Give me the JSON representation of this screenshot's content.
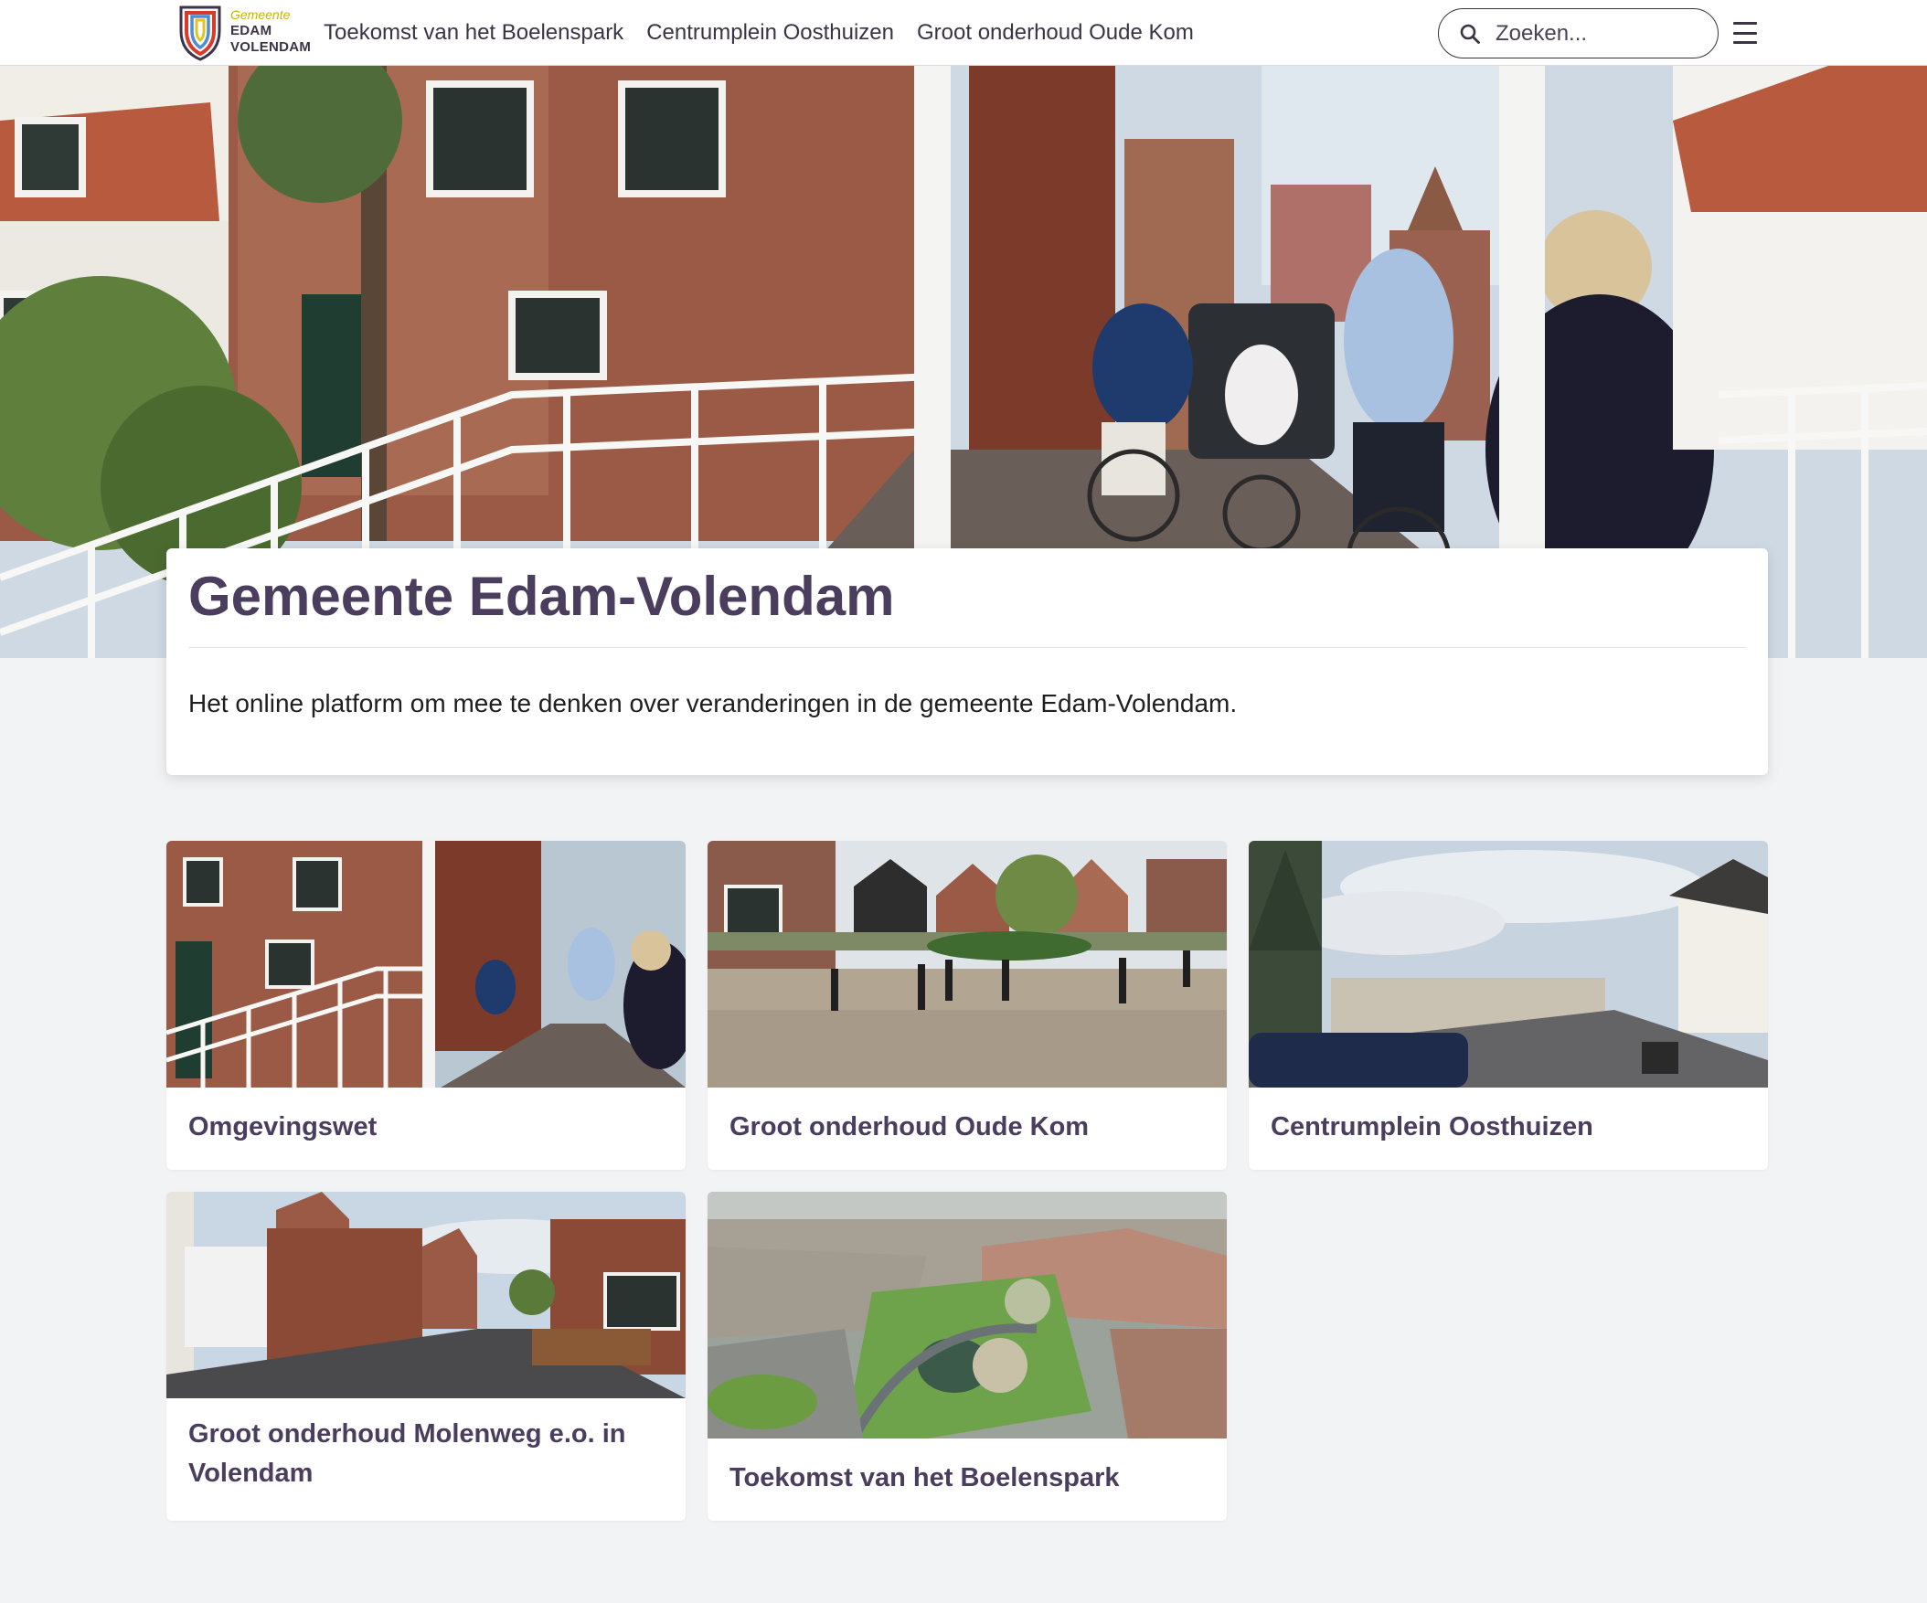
{
  "header": {
    "logo": {
      "line1": "Gemeente",
      "line2": "EDAM",
      "line3": "VOLENDAM"
    },
    "nav": [
      {
        "label": "Toekomst van het Boelenspark"
      },
      {
        "label": "Centrumplein Oosthuizen"
      },
      {
        "label": "Groot onderhoud Oude Kom"
      }
    ],
    "search": {
      "placeholder": "Zoeken..."
    }
  },
  "intro": {
    "title": "Gemeente Edam-Volendam",
    "description": "Het online platform om mee te denken over veranderingen in de gemeente Edam-Volendam."
  },
  "projects": [
    {
      "title": "Omgevingswet"
    },
    {
      "title": "Groot onderhoud Oude Kom"
    },
    {
      "title": "Centrumplein Oosthuizen"
    },
    {
      "title": "Groot onderhoud Molenweg e.o. in Volendam"
    },
    {
      "title": "Toekomst van het Boelenspark"
    }
  ],
  "colors": {
    "brand_purple": "#4a3d5e",
    "nav_text": "#3b3344",
    "page_background": "#f2f3f5"
  },
  "icons": {
    "search": "search-icon",
    "menu": "hamburger-menu-icon",
    "logo": "shield-logo-icon"
  }
}
